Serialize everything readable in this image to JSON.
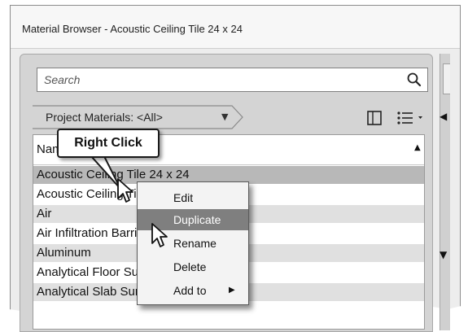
{
  "window": {
    "title": "Material Browser - Acoustic Ceiling Tile 24 x 24"
  },
  "search": {
    "placeholder": "Search"
  },
  "filter": {
    "label": "Project Materials: <All>"
  },
  "list": {
    "header": "Name",
    "rows": [
      "Acoustic Ceiling Tile 24 x 24",
      "Acoustic Ceiling Tile 24 x 48",
      "Air",
      "Air Infiltration Barrier",
      "Aluminum",
      "Analytical Floor Surface",
      "Analytical Slab Surface"
    ]
  },
  "context_menu": {
    "items": [
      "Edit",
      "Duplicate",
      "Rename",
      "Delete",
      "Add to"
    ]
  },
  "callout": {
    "label": "Right Click"
  },
  "colors": {
    "selected_row": "#b8b8b8",
    "alt_row": "#e0e0e0",
    "menu_highlight": "#7f7f7f"
  },
  "icons": [
    "search-icon",
    "panel-view-icon",
    "list-view-icon",
    "sort-ascending-icon",
    "submenu-arrow-icon",
    "mouse-pointer-icon"
  ]
}
